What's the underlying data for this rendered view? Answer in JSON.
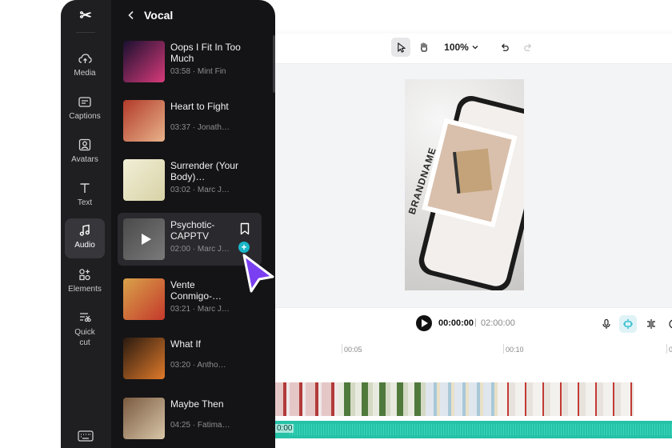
{
  "sidebar": {
    "logo": "✂",
    "items": [
      {
        "label": "Media",
        "icon": "cloud-upload-icon"
      },
      {
        "label": "Captions",
        "icon": "captions-icon"
      },
      {
        "label": "Avatars",
        "icon": "avatar-icon"
      },
      {
        "label": "Text",
        "icon": "text-icon"
      },
      {
        "label": "Audio",
        "icon": "music-note-icon",
        "active": true
      },
      {
        "label": "Elements",
        "icon": "elements-icon"
      },
      {
        "label": "Quick cut",
        "icon": "quick-cut-icon"
      }
    ]
  },
  "panel": {
    "title": "Vocal",
    "tracks": [
      {
        "title": "Oops I Fit In Too Much",
        "duration": "03:58",
        "artist": "Mint Fin",
        "thumb_colors": [
          "#1a1030",
          "#d83a7a"
        ]
      },
      {
        "title": "Heart to Fight",
        "duration": "03:37",
        "artist": "Jonath…",
        "thumb_colors": [
          "#b23a2a",
          "#e8b38a"
        ]
      },
      {
        "title": "Surrender (Your Body)…",
        "duration": "03:02",
        "artist": "Marc J…",
        "thumb_colors": [
          "#f1efd7",
          "#d8d2a6"
        ]
      },
      {
        "title": "Psychotic-CAPPTV",
        "duration": "02:00",
        "artist": "Marc J…",
        "thumb_colors": [
          "#4a4a4a",
          "#7a7a7a"
        ],
        "hovered": true
      },
      {
        "title": "Vente Conmigo-…",
        "duration": "03:21",
        "artist": "Marc J…",
        "thumb_colors": [
          "#d9a24a",
          "#c4392b"
        ]
      },
      {
        "title": "What If",
        "duration": "03:20",
        "artist": "Antho…",
        "thumb_colors": [
          "#2a1a10",
          "#e07a2a"
        ]
      },
      {
        "title": "Maybe Then",
        "duration": "04:25",
        "artist": "Fatima…",
        "thumb_colors": [
          "#7a5a40",
          "#d8c6a8"
        ]
      }
    ]
  },
  "toolbar": {
    "zoom": "100%"
  },
  "preview": {
    "brand_text": "BRANDNAME"
  },
  "playback": {
    "current": "00:00:00",
    "separator": "|",
    "total": "02:00:00"
  },
  "timeline": {
    "ticks": [
      "00:05",
      "00:10",
      "0"
    ],
    "audio_start": "0:00"
  },
  "colors": {
    "accent": "#18b6c9",
    "cursor": "#7b3ff2",
    "audio": "#25c2a8"
  }
}
